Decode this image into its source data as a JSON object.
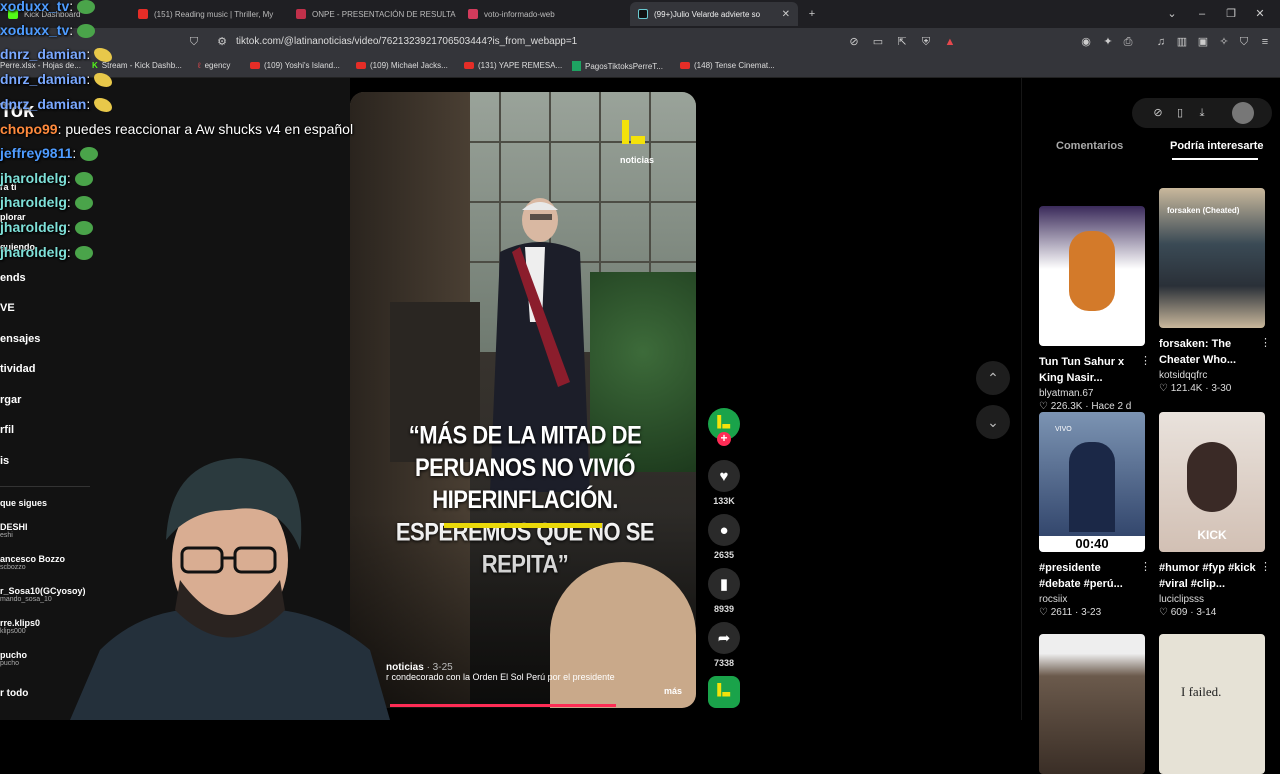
{
  "browser": {
    "tabs": [
      {
        "label": "Kick Dashboard"
      },
      {
        "label": "(151) Reading music | Thriller, My"
      },
      {
        "label": "ONPE - PRESENTACIÓN DE RESULTA"
      },
      {
        "label": "voto-informado-web"
      },
      {
        "label": "(99+)Julio Velarde advierte so"
      }
    ],
    "url": "tiktok.com/@latinanoticias/video/7621323921706503444?is_from_webapp=1",
    "bookmarks": [
      {
        "label": "Perre.xlsx - Hojas de..."
      },
      {
        "label": "Stream - Kick Dashb..."
      },
      {
        "label": "egency"
      },
      {
        "label": "(109) Yoshi's Island..."
      },
      {
        "label": "(109) Michael Jacks..."
      },
      {
        "label": "(131) YAPE REMESA..."
      },
      {
        "label": "PagosTiktoksPerreT..."
      },
      {
        "label": "(148) Tense Cinemat..."
      }
    ]
  },
  "sidebar": {
    "logo_fragment": "Tok",
    "nav": [
      "ra ti",
      "plorar",
      "guiendo",
      "ends",
      "VE",
      "ensajes",
      "tividad",
      "rgar",
      "rfil",
      "is"
    ],
    "following_title": "que sigues",
    "following": [
      {
        "name": "DESHI",
        "handle": "eshi"
      },
      {
        "name": "ancesco Bozzo",
        "handle": "scbozzo"
      },
      {
        "name": "r_Sosa10(GCyosoy)",
        "handle": "mando_sosa_10"
      },
      {
        "name": "rre.klips0",
        "handle": "klips000"
      },
      {
        "name": "pucho",
        "handle": "pucho"
      }
    ],
    "see_all": "r todo"
  },
  "chat": [
    {
      "user": "xoduxx_tv",
      "msg": "",
      "color": "#4f9cff"
    },
    {
      "user": "xoduxx_tv",
      "msg": "",
      "color": "#4f9cff"
    },
    {
      "user": "dnrz_damian",
      "msg": "",
      "color": "#7aa8ff"
    },
    {
      "user": "dnrz_damian",
      "msg": "",
      "color": "#7aa8ff"
    },
    {
      "user": "dnrz_damian",
      "msg": "",
      "color": "#7aa8ff"
    },
    {
      "user": "chopo99",
      "msg": "puedes reaccionar a Aw shucks v4 en español",
      "color": "#ff8a3d"
    },
    {
      "user": "jeffrey9811",
      "msg": "",
      "color": "#4f9cff"
    },
    {
      "user": "jharoldelg",
      "msg": "",
      "color": "#7ee0d8"
    },
    {
      "user": "jharoldelg",
      "msg": "",
      "color": "#7ee0d8"
    },
    {
      "user": "jharoldelg",
      "msg": "",
      "color": "#7ee0d8"
    },
    {
      "user": "jharoldelg",
      "msg": "",
      "color": "#7ee0d8"
    }
  ],
  "video": {
    "logo_text": "noticias",
    "quote": "“MÁS DE LA MITAD DE PERUANOS NO VIVIÓ HIPERINFLACIÓN. ESPEREMOS QUE NO SE REPITA”",
    "author": "noticias",
    "date": "· 3-25",
    "caption": "r condecorado con la Orden El Sol Perú por el presidente",
    "more": "más",
    "progress": 0.85
  },
  "actions": {
    "likes": "133K",
    "comments": "2635",
    "saves": "8939",
    "shares": "7338"
  },
  "right_panel": {
    "tab_comments": "Comentarios",
    "tab_suggested": "Podría interesarte",
    "cards": [
      {
        "title": "Tun Tun Sahur x King Nasir...",
        "user": "blyatman.67",
        "stats": "♡ 226.3K · Hace 2 d"
      },
      {
        "title": "forsaken: The Cheater Who...",
        "user": "kotsidqqfrc",
        "stats": "♡ 121.4K · 3-30",
        "overlay": "forsaken (Cheated)"
      },
      {
        "title": "#presidente #debate #perú...",
        "user": "rocsiix",
        "stats": "♡ 2611 · 3-23",
        "overlay": "00:40",
        "badge": "VIVO"
      },
      {
        "title": "#humor #fyp #kick #viral #clip...",
        "user": "luciclipsss",
        "stats": "♡ 609 · 3-14",
        "overlay": "KICK"
      },
      {
        "title": "",
        "user": "",
        "stats": "",
        "overlay": ""
      },
      {
        "title": "",
        "user": "",
        "stats": "",
        "overlay": "I failed."
      }
    ]
  },
  "colors": {
    "tiktok_red": "#fe2c55",
    "latina_green": "#1aa34a",
    "latina_yellow": "#f4e20a",
    "chat_blue": "#4f9cff",
    "chat_cyan": "#7ee0d8",
    "chat_orange": "#ff8a3d"
  }
}
